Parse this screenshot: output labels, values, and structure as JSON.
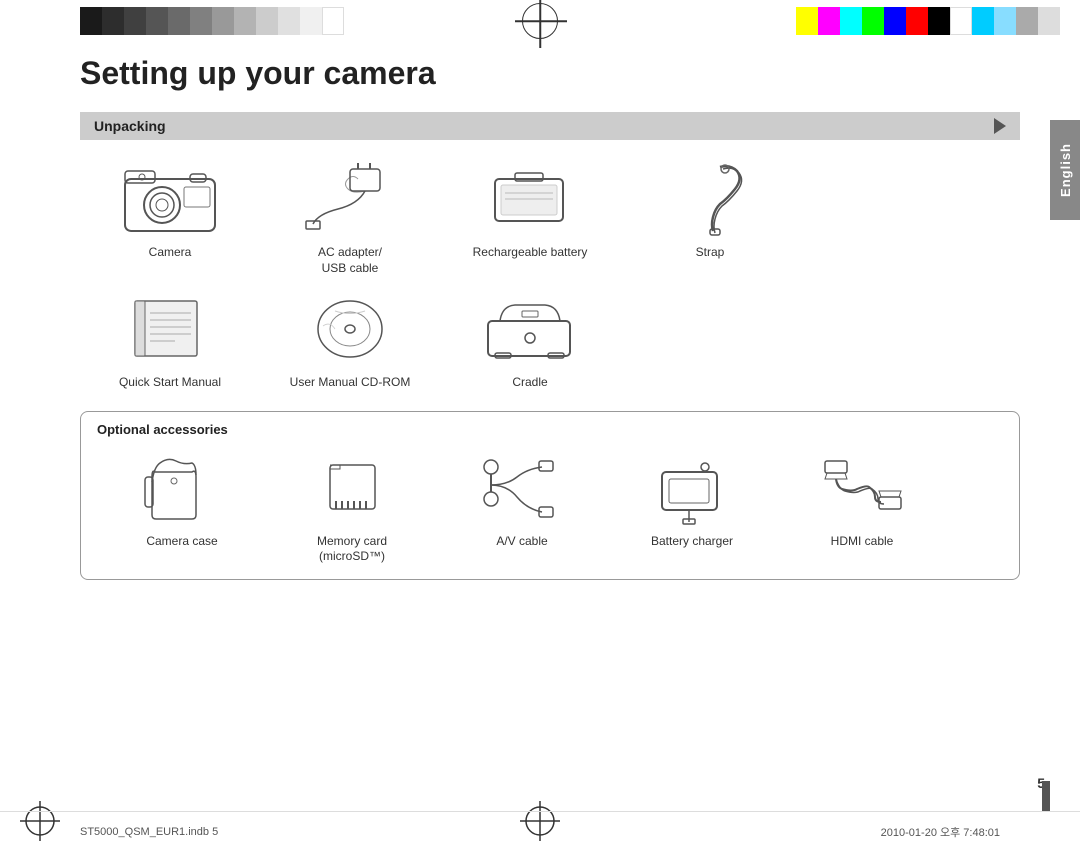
{
  "page": {
    "title": "Setting up your camera",
    "number": "5",
    "footer_left": "ST5000_QSM_EUR1.indb   5",
    "footer_right": "2010-01-20   오후 7:48:01"
  },
  "sidebar": {
    "language": "English"
  },
  "unpacking": {
    "title": "Unpacking",
    "items_row1": [
      {
        "label": "Camera"
      },
      {
        "label": "AC adapter/\nUSB cable"
      },
      {
        "label": "Rechargeable battery"
      },
      {
        "label": "Strap"
      }
    ],
    "items_row2": [
      {
        "label": "Quick Start Manual"
      },
      {
        "label": "User Manual CD-ROM"
      },
      {
        "label": "Cradle"
      }
    ]
  },
  "optional": {
    "title": "Optional accessories",
    "items": [
      {
        "label": "Camera case"
      },
      {
        "label": "Memory card\n(microSD™)"
      },
      {
        "label": "A/V cable"
      },
      {
        "label": "Battery charger"
      },
      {
        "label": "HDMI cable"
      }
    ]
  },
  "colors_left": [
    "#1a1a1a",
    "#2d2d2d",
    "#404040",
    "#555555",
    "#6a6a6a",
    "#808080",
    "#999999",
    "#b3b3b3",
    "#cccccc",
    "#e0e0e0",
    "#f5f5f5",
    "#ffffff"
  ],
  "colors_right": [
    "#ff00ff",
    "#ff80ff",
    "#00ffff",
    "#80ffff",
    "#00ff00",
    "#ffff00",
    "#ff4444",
    "#cc0000",
    "#000000",
    "#ffffff",
    "#00ccff",
    "#88ddff"
  ]
}
